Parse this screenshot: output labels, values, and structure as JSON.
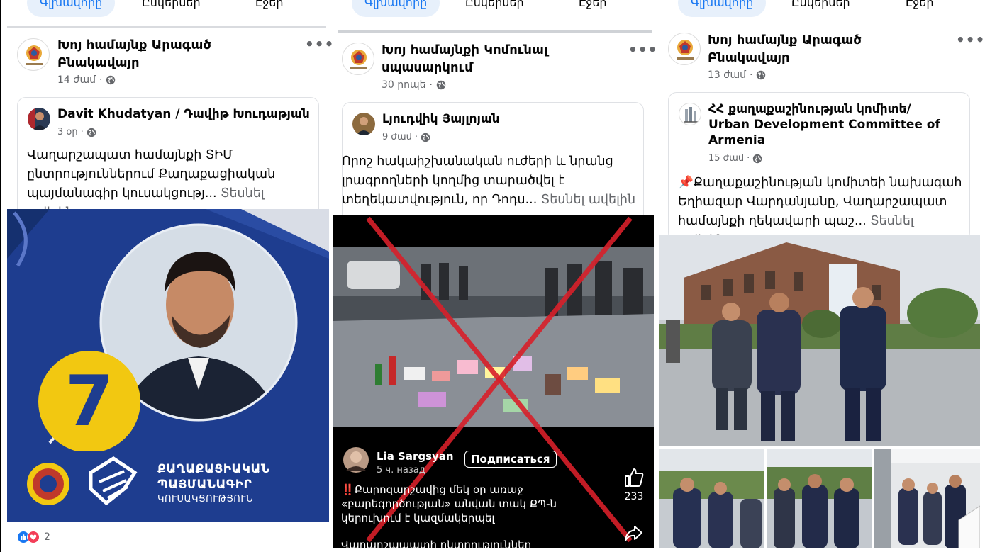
{
  "tabs": [
    "Գլխավորը",
    "Ընկերներ",
    "Էջեր"
  ],
  "posts": [
    {
      "page_name": "Խոյ համայնք Արագած Բնակավայր",
      "time": "14 ժամ",
      "shared_author": "Davit Khudatyan / Դավիթ Խուդաթյան",
      "shared_time": "3 օր",
      "text": "Վաղարշապատ համայնքի ՏԻՄ ընտրություններում Քաղաքացիական պայմանագիր կուսակցությ...",
      "see_more": "Տեսնել ավելին",
      "image": {
        "number": "7",
        "party_line1": "ՔԱՂԱՔԱՑԻԱԿԱՆ",
        "party_line2": "ՊԱՅՄԱՆԱԳԻՐ",
        "party_line3": "ԿՈՒՍԱԿՑՈՒԹՅՈՒՆ"
      },
      "reaction_count": "2"
    },
    {
      "page_name": "Խոյ համայնքի Կոմունալ սպասարկում",
      "time": "30 րոպե",
      "shared_author": "Լյուդվիկ Յայլոյան",
      "shared_time": "9 ժամ",
      "text": "Որոշ հակաիշխանական ուժերի և նրանց լրագրողների կողմից տարածվել է տեղեկատվություն, որ Դոդս...",
      "see_more": "Տեսնել ավելին",
      "embed": {
        "user": "Lia Sargsyan",
        "time_ago": "5 ч. назад",
        "subscribe": "Подписаться",
        "likes": "233",
        "caption_line1": "‼️Քարոզարշավից մեկ օր առաջ",
        "caption_line2": "«բարեգործության» անվան տակ ՔՊ-ն",
        "caption_line3": "կերուխում է կազմակերպել",
        "caption_line4": "Վաղարշապատի ընտրություններ"
      }
    },
    {
      "page_name": "Խոյ համայնք Արագած Բնակավայր",
      "time": "13 ժամ",
      "shared_author": "ՀՀ քաղաքաշինության կոմիտե/ Urban Development Committee of Armenia",
      "shared_time": "15 ժամ",
      "text": "📌Քաղաքաշինության կոմիտեի նախագահ Եղիազար Վարդանյանը, Վաղարշապատ համայնքի ղեկավարի պաշ...",
      "see_more": "Տեսնել ավելին"
    }
  ],
  "colors": {
    "fb_blue": "#1877f2",
    "meta_gray": "#65676b",
    "party_navy": "#1d3a8a",
    "party_yellow": "#f2c811",
    "cross_red": "#d8202a"
  }
}
